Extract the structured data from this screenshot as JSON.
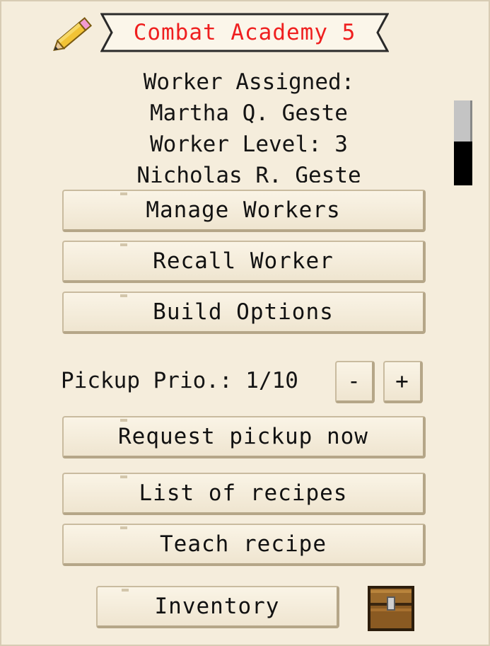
{
  "header": {
    "title": "Combat Academy 5",
    "title_color": "#ef1f1f",
    "edit_icon": "pencil-icon"
  },
  "info": {
    "lines": [
      "Worker Assigned:",
      "Martha Q. Geste",
      "Worker Level: 3",
      "Nicholas R. Geste"
    ]
  },
  "buttons": {
    "manage_workers": "Manage Workers",
    "recall_worker": "Recall Worker",
    "build_options": "Build Options",
    "request_pickup": "Request pickup now",
    "list_recipes": "List of recipes",
    "teach_recipe": "Teach recipe",
    "inventory": "Inventory"
  },
  "pickup": {
    "label": "Pickup Prio.: 1/10",
    "minus": "-",
    "plus": "+"
  },
  "icons": {
    "chest": "chest-icon"
  }
}
